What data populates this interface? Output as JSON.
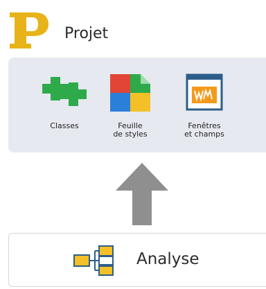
{
  "header": {
    "title": "Projet",
    "logo_icon": "letter-p-logo-icon"
  },
  "tools": [
    {
      "label_line1": "Classes",
      "label_line2": "",
      "icon": "classes-plus-icon"
    },
    {
      "label_line1": "Feuille",
      "label_line2": "de styles",
      "icon": "stylesheet-icon"
    },
    {
      "label_line1": "Fenêtres",
      "label_line2": "et champs",
      "icon": "window-fields-icon"
    }
  ],
  "flow": {
    "icon": "up-arrow-icon",
    "color": "#8f8f8f"
  },
  "analysis": {
    "label": "Analyse",
    "icon": "analysis-diagram-icon"
  },
  "colors": {
    "logo": "#e7b318",
    "panel_bg": "#e6e9ef",
    "green": "#2eaa4b",
    "red": "#e24535",
    "blue": "#2c7fd8",
    "yellow": "#f3c027",
    "orange": "#f39a1c"
  }
}
